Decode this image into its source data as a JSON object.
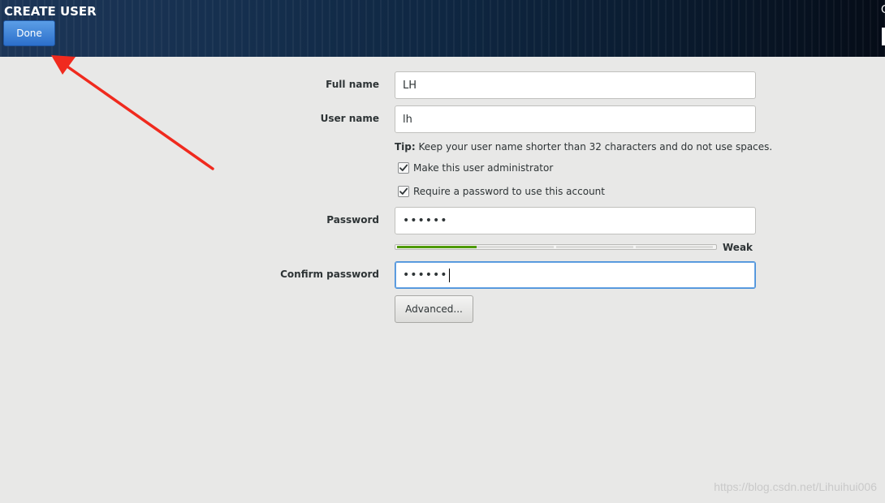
{
  "header": {
    "title": "CREATE USER",
    "done_label": "Done",
    "edge_char": "C"
  },
  "form": {
    "full_name": {
      "label": "Full name",
      "value": "LH"
    },
    "user_name": {
      "label": "User name",
      "value": "lh"
    },
    "tip": {
      "prefix": "Tip:",
      "text": " Keep your user name shorter than 32 characters and do not use spaces."
    },
    "admin_checkbox": {
      "label": "Make this user administrator",
      "checked": true
    },
    "require_password_checkbox": {
      "label": "Require a password to use this account",
      "checked": true
    },
    "password": {
      "label": "Password",
      "value": "••••••"
    },
    "strength": {
      "label": "Weak",
      "level": 0.25,
      "color": "#4e9a06"
    },
    "confirm_password": {
      "label": "Confirm password",
      "value": "••••••"
    },
    "advanced_label": "Advanced..."
  },
  "watermark": "https://blog.csdn.net/Lihuihui006",
  "annotation": {
    "arrow_color": "#f02a1e"
  }
}
